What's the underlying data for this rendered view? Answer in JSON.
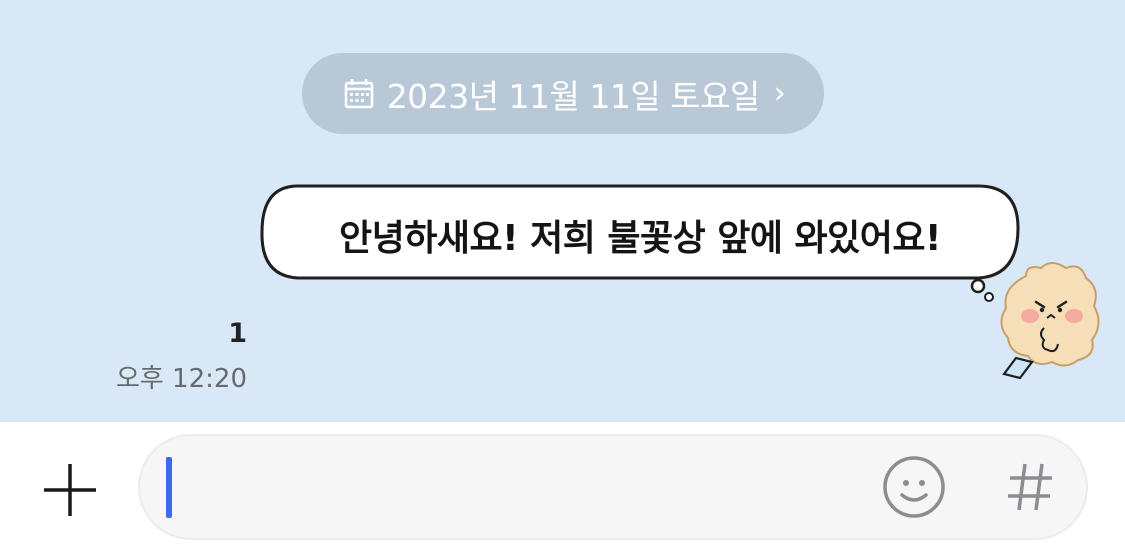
{
  "date_divider": {
    "label": "2023년 11월 11일 토요일",
    "chevron": "›",
    "icon": "calendar-icon"
  },
  "message": {
    "text": "안녕하새요! 저희 불꽃상 앞에 와있어요!",
    "unread_count": "1",
    "time": "오후 12:20",
    "sticker": "bear-thought-bubble-sticker"
  },
  "composer": {
    "value": "",
    "left_icon": "plus-icon",
    "right_icons": [
      "emoji-icon",
      "hash-icon"
    ],
    "accent": "#3b6cf0"
  },
  "colors": {
    "chat_background": "#d9e8f7",
    "date_pill": "#b9c8d6",
    "input_background": "#f6f6f6"
  }
}
